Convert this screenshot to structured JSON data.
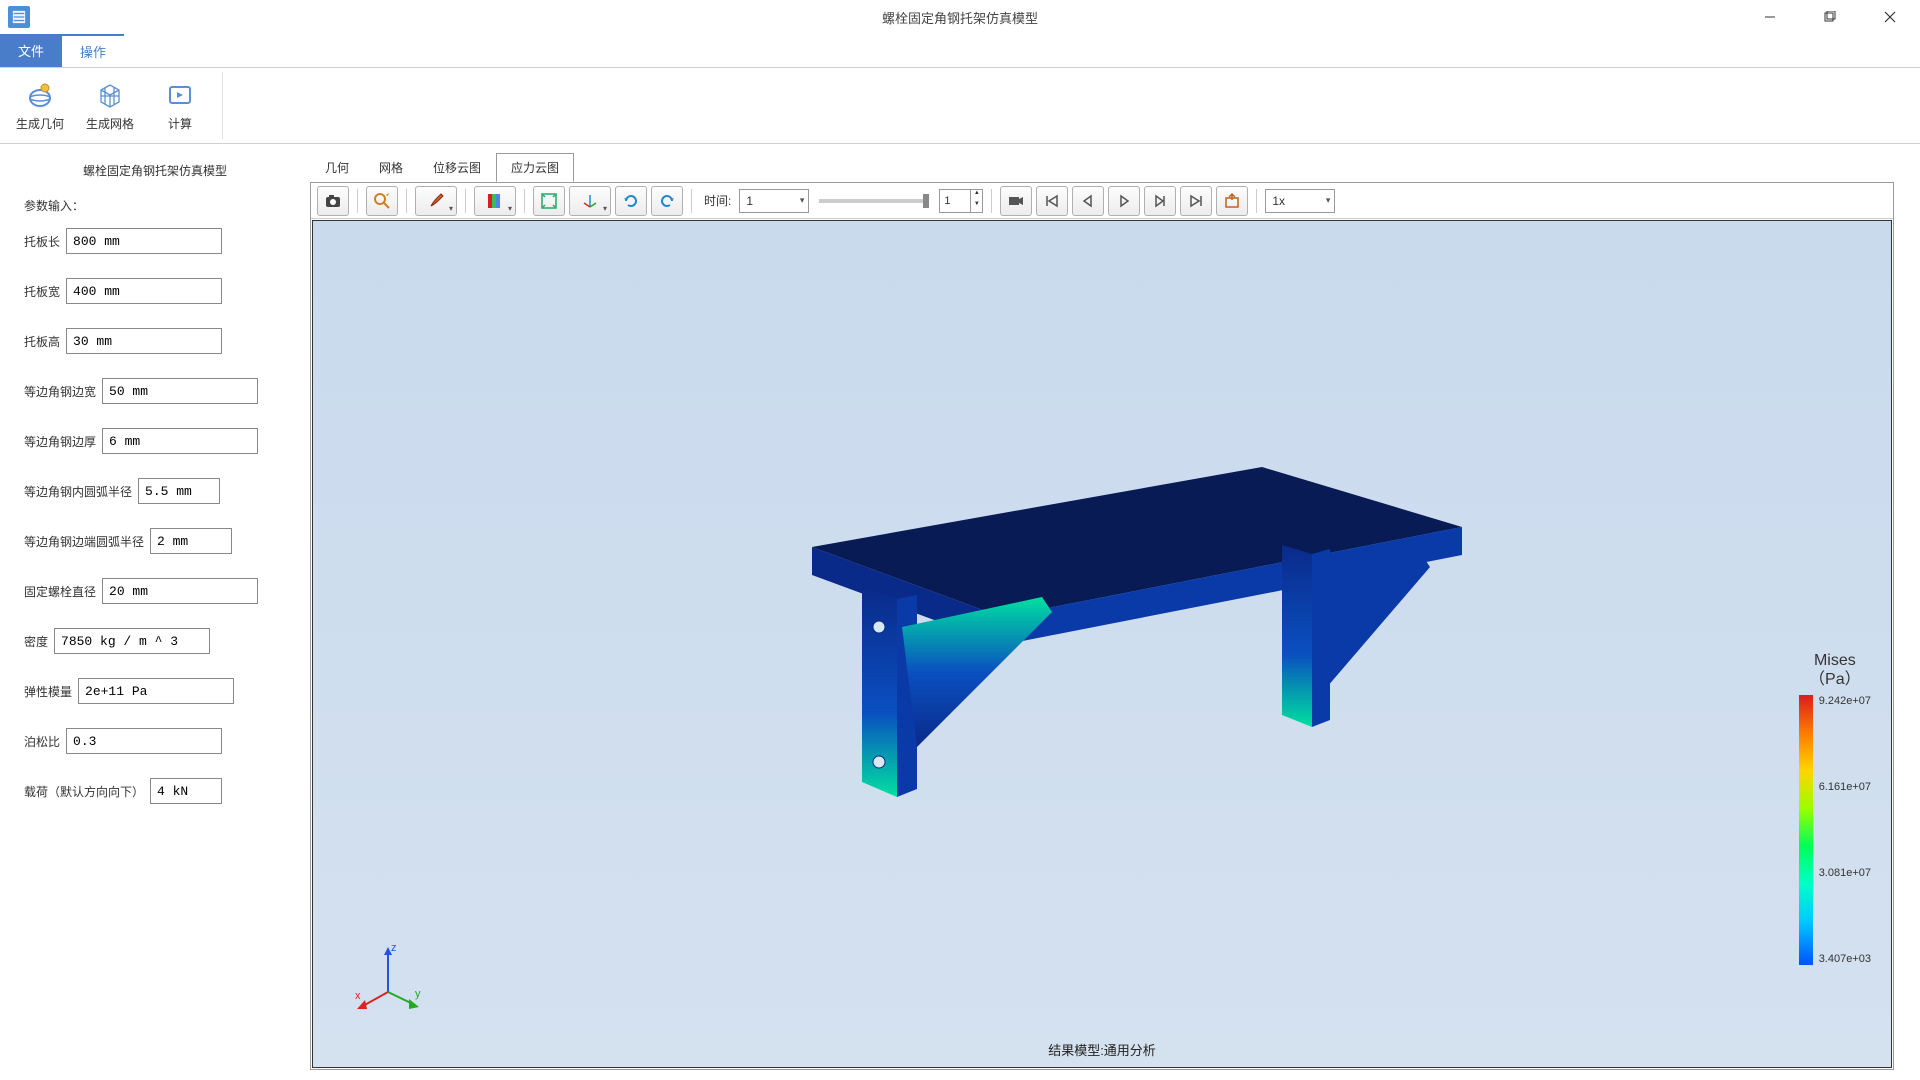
{
  "window": {
    "title": "螺栓固定角钢托架仿真模型"
  },
  "menubar": {
    "file": "文件",
    "operate": "操作"
  },
  "ribbon": {
    "gen_geometry": "生成几何",
    "gen_mesh": "生成网格",
    "compute": "计算"
  },
  "sidebar": {
    "title": "螺栓固定角钢托架仿真模型",
    "section": "参数输入：",
    "params": [
      {
        "label": "托板长",
        "value": "800 mm"
      },
      {
        "label": "托板宽",
        "value": "400 mm"
      },
      {
        "label": "托板高",
        "value": "30 mm"
      },
      {
        "label": "等边角钢边宽",
        "value": "50 mm"
      },
      {
        "label": "等边角钢边厚",
        "value": "6 mm"
      },
      {
        "label": "等边角钢内圆弧半径",
        "value": "5.5 mm"
      },
      {
        "label": "等边角钢边端圆弧半径",
        "value": "2 mm"
      },
      {
        "label": "固定螺栓直径",
        "value": "20 mm"
      },
      {
        "label": "密度",
        "value": "7850 kg / m ^ 3"
      },
      {
        "label": "弹性模量",
        "value": "2e+11 Pa"
      },
      {
        "label": "泊松比",
        "value": "0.3"
      },
      {
        "label": "载荷（默认方向向下）",
        "value": "4 kN"
      }
    ]
  },
  "view_tabs": {
    "geometry": "几何",
    "mesh": "网格",
    "disp": "位移云图",
    "stress": "应力云图"
  },
  "toolbar": {
    "time_label": "时间:",
    "time_value": "1",
    "frame_value": "1",
    "speed_value": "1x"
  },
  "legend": {
    "title_l1": "Mises",
    "title_l2": "（Pa）",
    "ticks": [
      "9.242e+07",
      "6.161e+07",
      "3.081e+07",
      "3.407e+03"
    ]
  },
  "axes": {
    "x": "x",
    "y": "y",
    "z": "z"
  },
  "result_label": "结果模型:通用分析",
  "icons": {
    "camera": "camera-icon",
    "zoom": "zoom-icon",
    "brush": "brush-icon",
    "shade": "shade-icon",
    "fit": "fit-icon",
    "axis": "axis-icon",
    "rot1": "rotate-ccw-icon",
    "rot2": "rotate-cw-icon",
    "vcam": "video-icon",
    "first": "first-frame-icon",
    "prev": "prev-frame-icon",
    "play": "play-icon",
    "next": "next-frame-icon",
    "last": "last-frame-icon",
    "export": "export-icon"
  }
}
